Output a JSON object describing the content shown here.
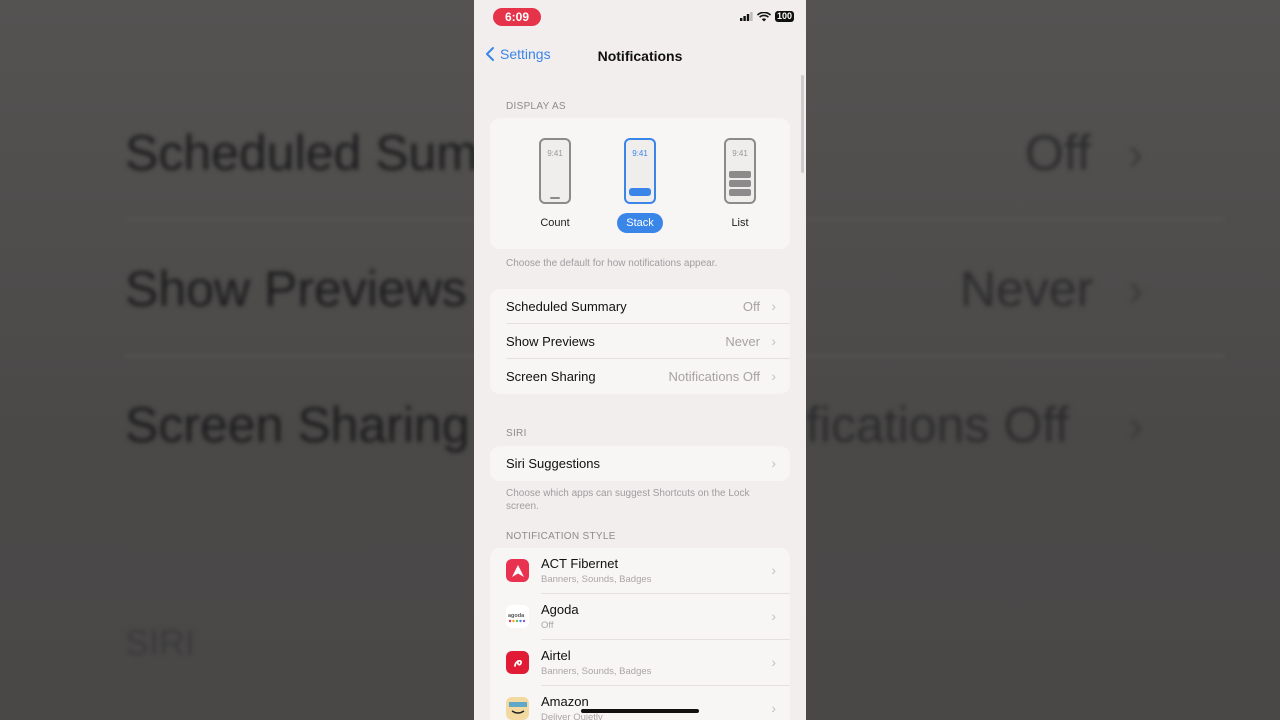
{
  "background": {
    "rows": [
      {
        "title": "Scheduled Sum",
        "value": "Off"
      },
      {
        "title": "Show Previews",
        "value": "Never"
      },
      {
        "title": "Screen Sharing",
        "value": "fications Off"
      }
    ],
    "siri_header": "SIRI"
  },
  "status_bar": {
    "time": "6:09",
    "battery": "100"
  },
  "nav": {
    "back_label": "Settings",
    "title": "Notifications"
  },
  "display_as": {
    "header": "DISPLAY AS",
    "modes": [
      {
        "label": "Count",
        "clock": "9:41",
        "selected": false
      },
      {
        "label": "Stack",
        "clock": "9:41",
        "selected": true
      },
      {
        "label": "List",
        "clock": "9:41",
        "selected": false
      }
    ],
    "footnote": "Choose the default for how notifications appear."
  },
  "settings_rows": [
    {
      "title": "Scheduled Summary",
      "value": "Off"
    },
    {
      "title": "Show Previews",
      "value": "Never"
    },
    {
      "title": "Screen Sharing",
      "value": "Notifications Off"
    }
  ],
  "siri": {
    "header": "SIRI",
    "row_title": "Siri Suggestions",
    "footnote": "Choose which apps can suggest Shortcuts on the Lock screen."
  },
  "notification_style": {
    "header": "NOTIFICATION STYLE",
    "apps": [
      {
        "name": "ACT Fibernet",
        "detail": "Banners, Sounds, Badges",
        "icon": "act-fibernet-icon",
        "color": "#e8324f"
      },
      {
        "name": "Agoda",
        "detail": "Off",
        "icon": "agoda-icon",
        "color": "#ffffff"
      },
      {
        "name": "Airtel",
        "detail": "Banners, Sounds, Badges",
        "icon": "airtel-icon",
        "color": "#e11b36"
      },
      {
        "name": "Amazon",
        "detail": "Deliver Quietly",
        "icon": "amazon-icon",
        "color": "#f2d9a0"
      }
    ]
  },
  "colors": {
    "accent": "#3a86e8",
    "time_pill": "#e5334a"
  }
}
